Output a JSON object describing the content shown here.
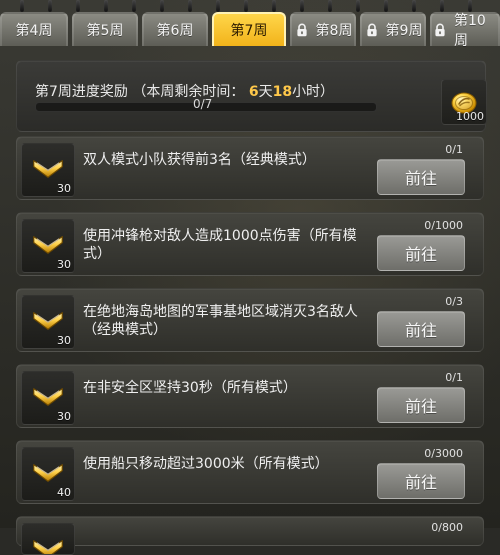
{
  "tabs": [
    {
      "label": "第4周",
      "state": "normal"
    },
    {
      "label": "第5周",
      "state": "normal"
    },
    {
      "label": "第6周",
      "state": "normal"
    },
    {
      "label": "第7周",
      "state": "active"
    },
    {
      "label": "第8周",
      "state": "locked"
    },
    {
      "label": "第9周",
      "state": "locked"
    },
    {
      "label": "第10周",
      "state": "locked"
    }
  ],
  "header": {
    "title_prefix": "第7周进度奖励",
    "remaining_label": "（本周剩余时间：",
    "days": "6",
    "days_unit": "天",
    "hours": "18",
    "hours_unit": "小时）",
    "progress_text": "0/7",
    "progress_value": 0,
    "progress_max": 7,
    "reward": {
      "icon": "gold-coin-icon",
      "quantity": "1000"
    }
  },
  "tasks": [
    {
      "icon": "chevron-badge-icon",
      "quantity": "30",
      "text": "双人模式小队获得前3名（经典模式）",
      "count": "0/1",
      "button": "前往"
    },
    {
      "icon": "chevron-badge-icon",
      "quantity": "30",
      "text": "使用冲锋枪对敌人造成1000点伤害（所有模式）",
      "count": "0/1000",
      "button": "前往"
    },
    {
      "icon": "chevron-badge-icon",
      "quantity": "30",
      "text": "在绝地海岛地图的军事基地区域消灭3名敌人（经典模式）",
      "count": "0/3",
      "button": "前往"
    },
    {
      "icon": "chevron-badge-icon",
      "quantity": "30",
      "text": "在非安全区坚持30秒（所有模式）",
      "count": "0/1",
      "button": "前往"
    },
    {
      "icon": "chevron-badge-icon",
      "quantity": "40",
      "text": "使用船只移动超过3000米（所有模式）",
      "count": "0/3000",
      "button": "前往"
    },
    {
      "icon": "chevron-badge-icon",
      "quantity": "",
      "text": "",
      "count": "0/800",
      "button": ""
    }
  ],
  "colors": {
    "accent": "#f2b31a",
    "tab_normal": "#6f6f69",
    "panel": "#2f2f2a"
  }
}
